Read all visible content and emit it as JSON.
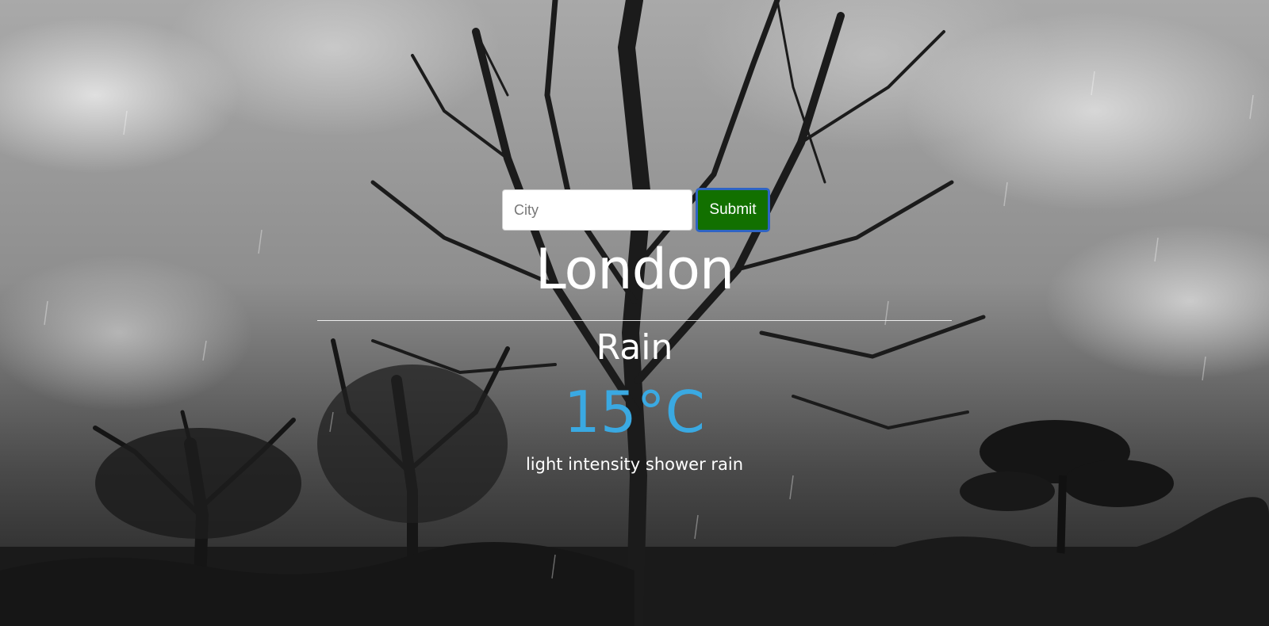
{
  "search": {
    "placeholder": "City",
    "value": "",
    "submit_label": "Submit",
    "submit_color": "#127000"
  },
  "weather": {
    "city": "London",
    "condition": "Rain",
    "temperature": "15°C",
    "temperature_color": "#3aa9e2",
    "description": "light intensity shower rain"
  },
  "background": {
    "icon": "rainy-trees-background"
  }
}
